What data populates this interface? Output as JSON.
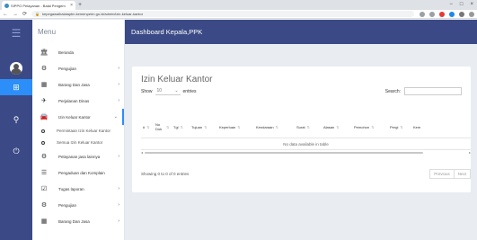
{
  "browser": {
    "tab_title": "SIPPO Pelayanan - Balai Pengem",
    "tab_close": "×",
    "new_tab": "+",
    "url": "kepegawaibalaiapbn.kemenperin.go.id/admin/izin-keluar-kantor",
    "controls": [
      "−",
      "□",
      "×"
    ]
  },
  "sidebar": {
    "brand": "Menu",
    "items": [
      {
        "icon": "bank-icon",
        "glyph": "🏛",
        "label": "Beranda",
        "caret": ""
      },
      {
        "icon": "cogs-icon",
        "glyph": "⚙",
        "label": "Pengujian",
        "caret": "›"
      },
      {
        "icon": "calendar-icon",
        "glyph": "▦",
        "label": "Barang Dan Jasa",
        "caret": "›"
      },
      {
        "icon": "plane-icon",
        "glyph": "✈",
        "label": "Perjalanan Dinas",
        "caret": "›"
      },
      {
        "icon": "car-icon",
        "glyph": "🚘",
        "label": "Izin Keluar Kantor",
        "caret": "⌄"
      }
    ],
    "sub_items": [
      {
        "label": "Permintaan Izin Keluar Kantor"
      },
      {
        "label": "Semua Izin Keluar Kantor"
      }
    ],
    "items2": [
      {
        "icon": "gear-icon",
        "glyph": "⚙",
        "label": "Pelayanan jasa lainnya",
        "caret": "›"
      },
      {
        "icon": "list-icon",
        "glyph": "☰",
        "label": "Pengaduan dan Komplain",
        "caret": ""
      },
      {
        "icon": "calendar-check-icon",
        "glyph": "☑",
        "label": "Tugas laporan",
        "caret": "›"
      },
      {
        "icon": "cogs-icon",
        "glyph": "⚙",
        "label": "Pengujian",
        "caret": "›"
      },
      {
        "icon": "calendar-icon",
        "glyph": "▦",
        "label": "Barang Dan Jasa",
        "caret": "›"
      }
    ]
  },
  "topbar": {
    "title": "Dashboard Kepala,PPK"
  },
  "card": {
    "title": "Izin Keluar Kantor",
    "show_label": "Show",
    "entries_value": "10",
    "entries_label": "entries",
    "search_label": "Search:",
    "columns": [
      "#",
      "No Dok",
      "Tgl",
      "Tujuan",
      "Keperluan",
      "Kendaraan",
      "Surat",
      "Alasan",
      "Pemohon",
      "Pergi",
      "Kem"
    ],
    "empty_message": "No data available in table",
    "info": "Showing 0 to 0 of 0 entries",
    "previous": "Previous",
    "next": "Next"
  },
  "colors": {
    "rail": "#3b4a86",
    "accent": "#2c8ef8"
  }
}
